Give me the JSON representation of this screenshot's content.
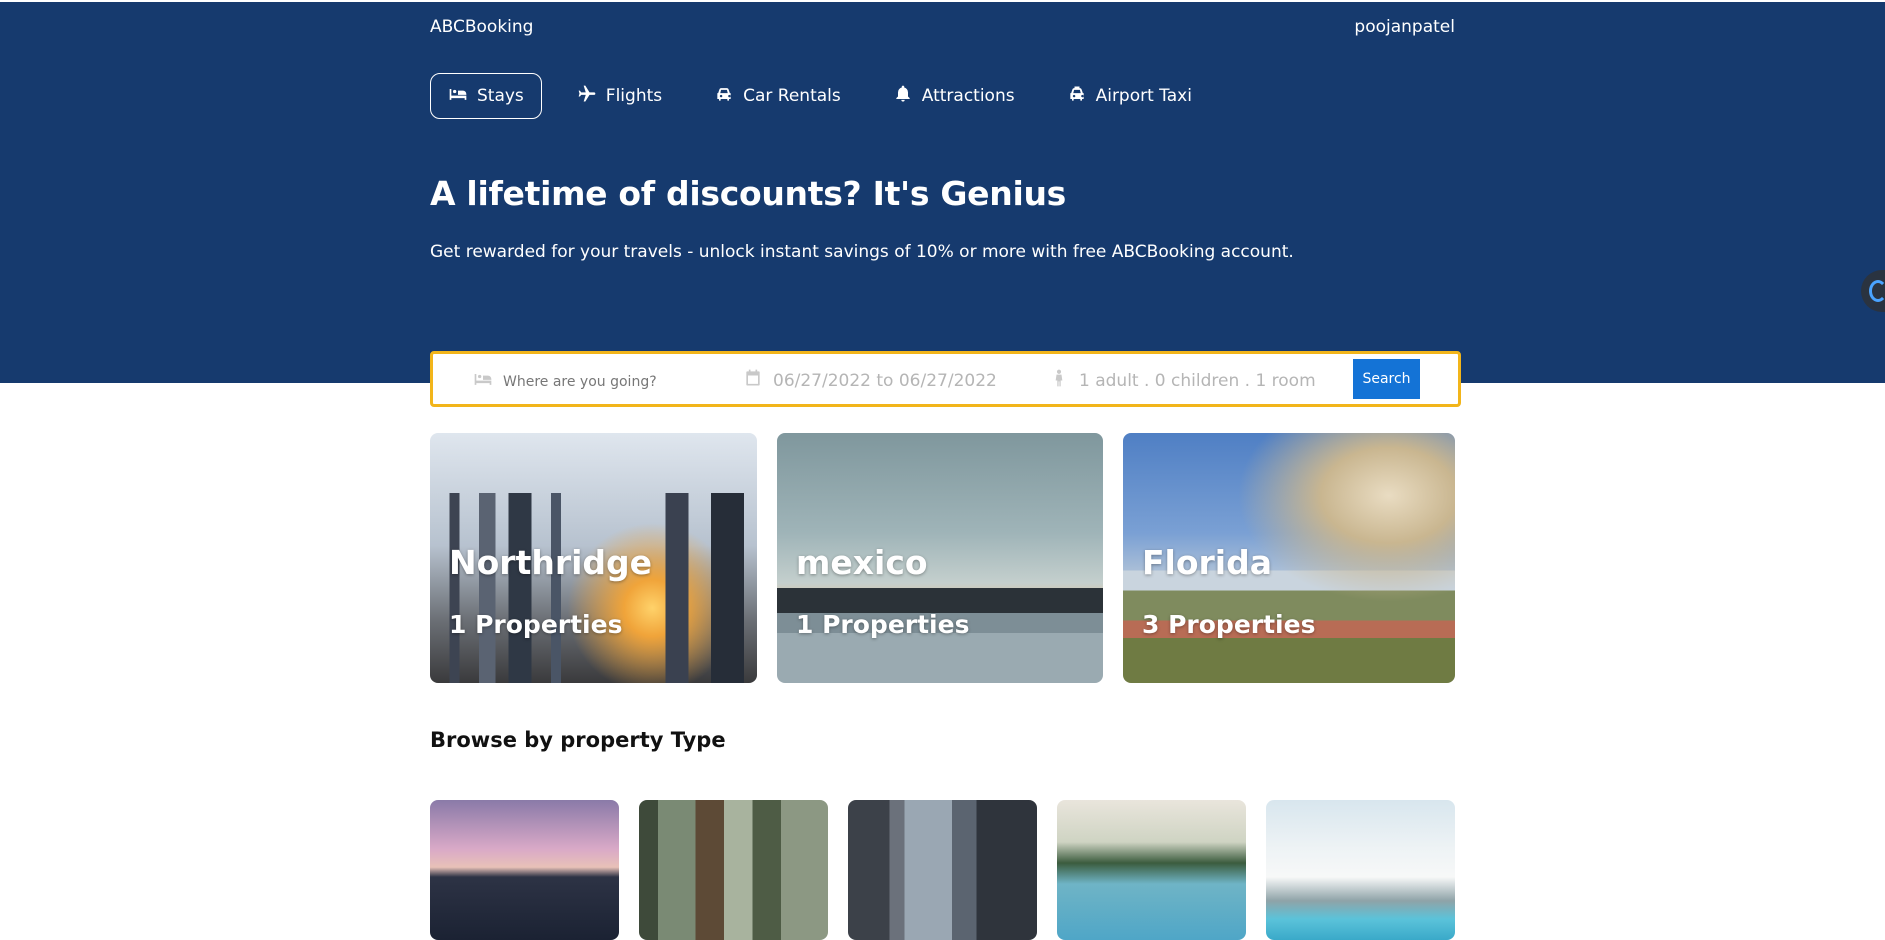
{
  "header": {
    "brand": "ABCBooking",
    "username": "poojanpatel",
    "bg_color": "#163a6e"
  },
  "nav": {
    "items": [
      {
        "label": "Stays",
        "icon": "bed-icon",
        "active": true
      },
      {
        "label": "Flights",
        "icon": "plane-icon",
        "active": false
      },
      {
        "label": "Car Rentals",
        "icon": "car-icon",
        "active": false
      },
      {
        "label": "Attractions",
        "icon": "bell-icon",
        "active": false
      },
      {
        "label": "Airport Taxi",
        "icon": "taxi-icon",
        "active": false
      }
    ]
  },
  "hero": {
    "title": "A lifetime of discounts? It's Genius",
    "subtitle": "Get rewarded for your travels - unlock instant savings of 10% or more with free ABCBooking account."
  },
  "search": {
    "destination_placeholder": "Where are you going?",
    "dates": "06/27/2022 to 06/27/2022",
    "guests": "1 adult . 0 children . 1 room",
    "button_label": "Search",
    "border_color": "#f2b51a",
    "button_color": "#1473d6"
  },
  "featured": [
    {
      "city": "Northridge",
      "properties": "1 Properties"
    },
    {
      "city": "mexico",
      "properties": "1 Properties"
    },
    {
      "city": "Florida",
      "properties": "3 Properties"
    }
  ],
  "browse": {
    "title": "Browse by property Type"
  }
}
